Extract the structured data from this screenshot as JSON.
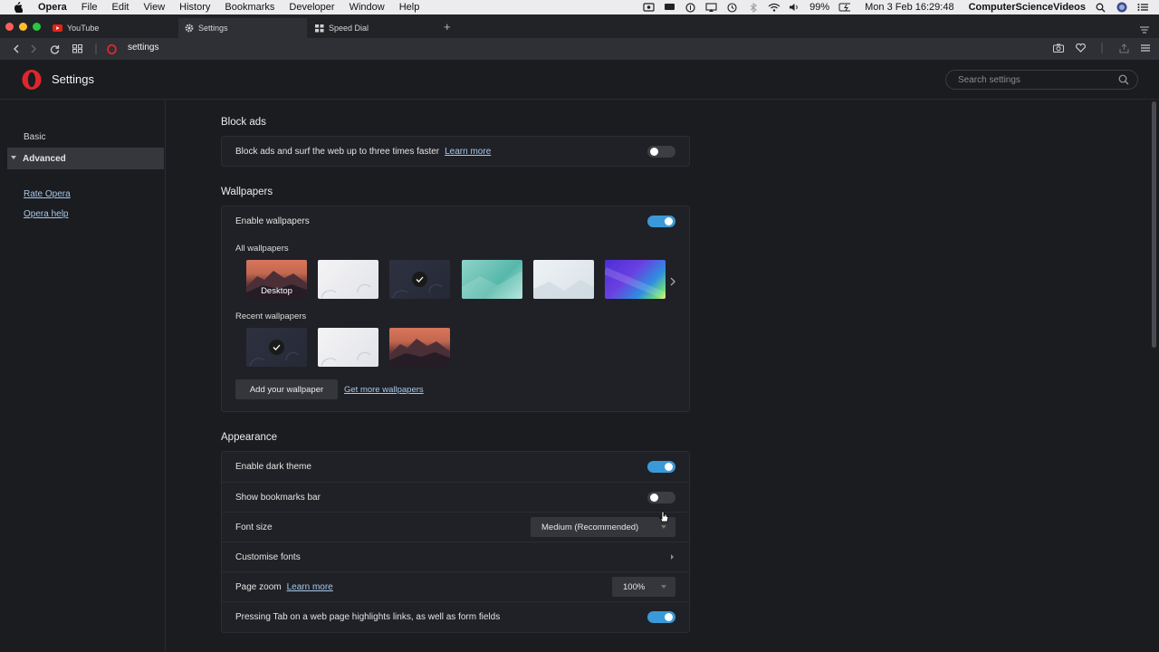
{
  "menubar": {
    "app": "Opera",
    "items": [
      "File",
      "Edit",
      "View",
      "History",
      "Bookmarks",
      "Developer",
      "Window",
      "Help"
    ],
    "battery": "99%",
    "clock": "Mon 3 Feb  16:29:48",
    "user": "ComputerScienceVideos"
  },
  "tabs": [
    {
      "label": "YouTube",
      "icon": "youtube-icon"
    },
    {
      "label": "Settings",
      "icon": "gear-icon",
      "active": true
    },
    {
      "label": "Speed Dial",
      "icon": "grid-icon"
    }
  ],
  "address": {
    "url": "settings"
  },
  "header": {
    "title": "Settings",
    "search_placeholder": "Search settings"
  },
  "sidebar": {
    "basic": "Basic",
    "advanced": "Advanced",
    "links": [
      "Rate Opera",
      "Opera help"
    ]
  },
  "block_ads": {
    "title": "Block ads",
    "label": "Block ads and surf the web up to three times faster",
    "link": "Learn more",
    "enabled": false
  },
  "wallpapers": {
    "title": "Wallpapers",
    "enable_label": "Enable wallpapers",
    "enabled": true,
    "all_label": "All wallpapers",
    "desktop_label": "Desktop",
    "recent_label": "Recent wallpapers",
    "add_button": "Add your wallpaper",
    "more_link": "Get more wallpapers"
  },
  "appearance": {
    "title": "Appearance",
    "dark_theme_label": "Enable dark theme",
    "dark_theme": true,
    "bookmarks_bar_label": "Show bookmarks bar",
    "bookmarks_bar": false,
    "font_size_label": "Font size",
    "font_size_value": "Medium (Recommended)",
    "customise_fonts_label": "Customise fonts",
    "page_zoom_label": "Page zoom",
    "page_zoom_link": "Learn more",
    "page_zoom_value": "100%",
    "tab_highlight_label": "Pressing Tab on a web page highlights links, as well as form fields",
    "tab_highlight": true
  },
  "colors": {
    "accent": "#3a9ad9",
    "link": "#a6c8ec",
    "opera_red": "#e0262d"
  }
}
